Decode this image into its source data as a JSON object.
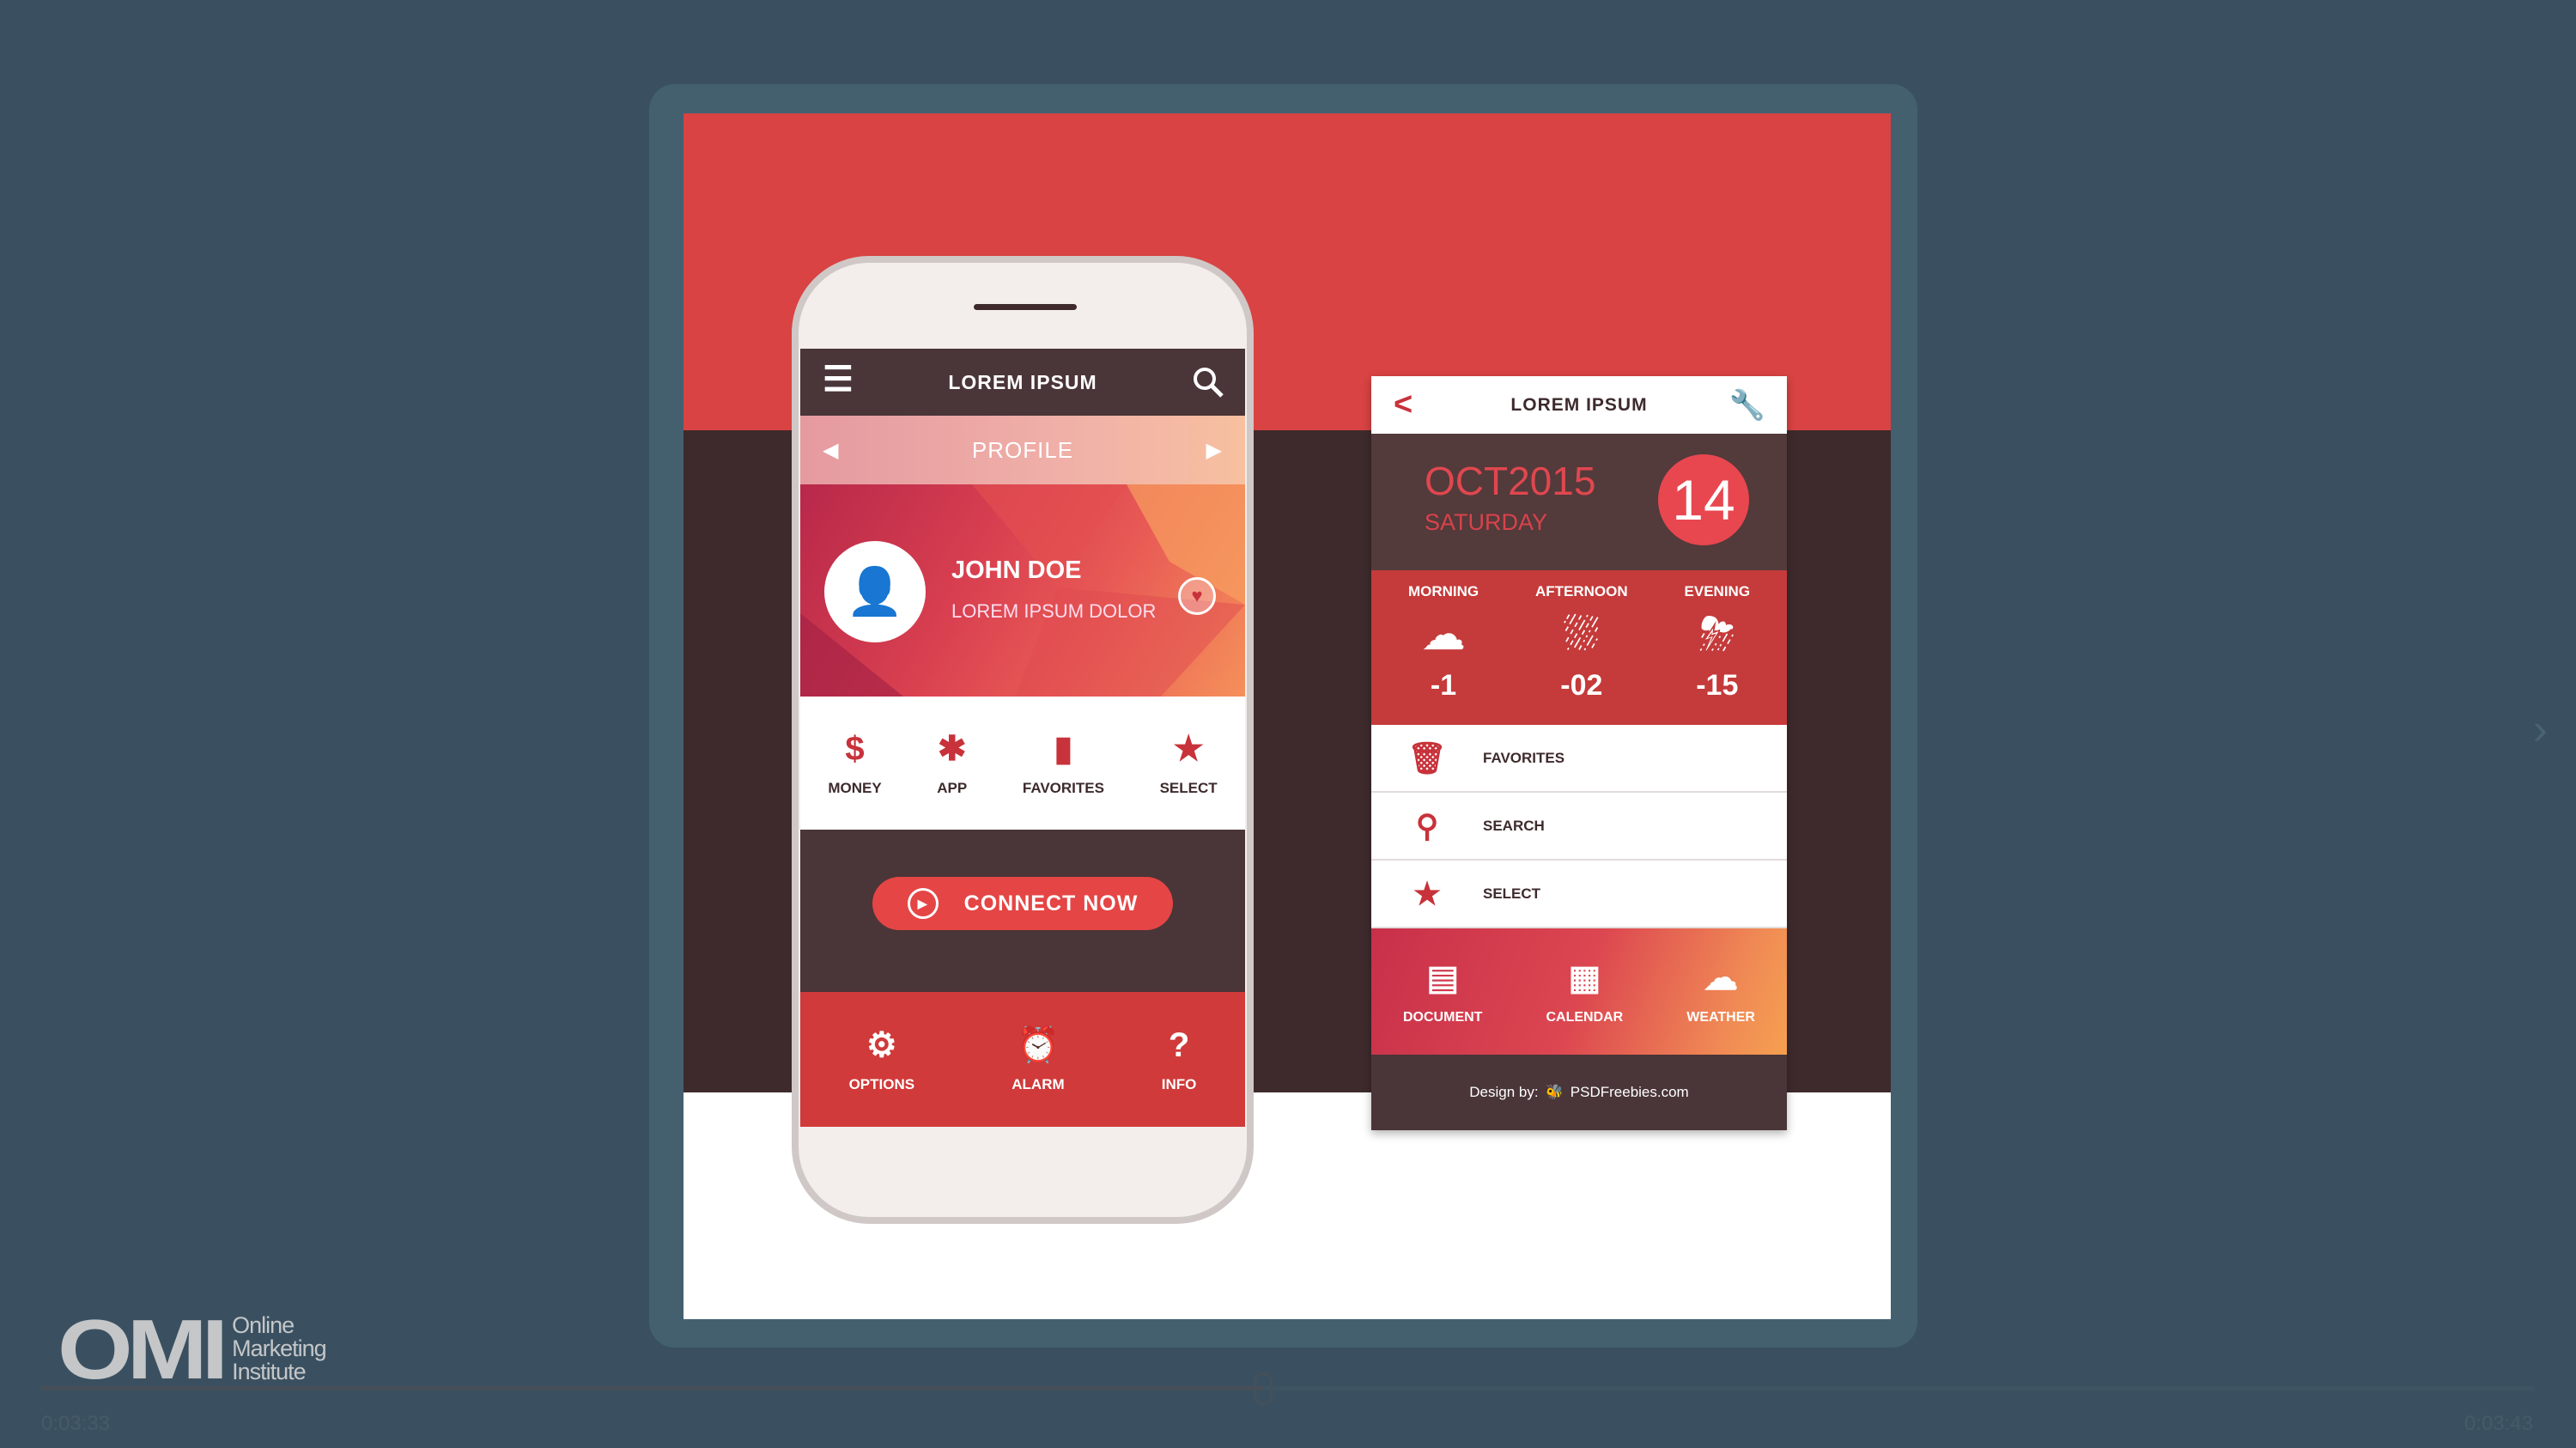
{
  "player": {
    "time_elapsed": "0:03:33",
    "time_total": "0:03:43",
    "progress": 0.49
  },
  "logo": {
    "mark": "OMI",
    "line1": "Online",
    "line2": "Marketing",
    "line3": "Institute"
  },
  "phone": {
    "header_title": "LOREM IPSUM",
    "profile_label": "PROFILE",
    "user_name": "JOHN DOE",
    "user_subtitle": "LOREM IPSUM DOLOR",
    "icons": [
      {
        "label": "MONEY",
        "icon": "dollar-icon"
      },
      {
        "label": "APP",
        "icon": "puzzle-icon"
      },
      {
        "label": "FAVORITES",
        "icon": "bookmark-icon"
      },
      {
        "label": "SELECT",
        "icon": "star-icon"
      }
    ],
    "connect_label": "CONNECT NOW",
    "bottom": [
      {
        "label": "OPTIONS",
        "icon": "gear-icon"
      },
      {
        "label": "ALARM",
        "icon": "alarm-icon"
      },
      {
        "label": "INFO",
        "icon": "question-icon"
      }
    ]
  },
  "card": {
    "header_title": "LOREM IPSUM",
    "month_year": "OCT2015",
    "weekday": "SATURDAY",
    "day": "14",
    "weather": [
      {
        "label": "MORNING",
        "temp": "-1",
        "icon": "cloud-icon"
      },
      {
        "label": "AFTERNOON",
        "temp": "-02",
        "icon": "rain-icon"
      },
      {
        "label": "EVENING",
        "temp": "-15",
        "icon": "storm-sun-icon"
      }
    ],
    "list": [
      {
        "label": "FAVORITES",
        "icon": "trash-icon"
      },
      {
        "label": "SEARCH",
        "icon": "search-icon"
      },
      {
        "label": "SELECT",
        "icon": "star-icon"
      }
    ],
    "icons": [
      {
        "label": "DOCUMENT",
        "icon": "document-icon"
      },
      {
        "label": "CALENDAR",
        "icon": "calendar-icon"
      },
      {
        "label": "WEATHER",
        "icon": "cloud-icon"
      }
    ],
    "footer_prefix": "Design by:",
    "footer_brand": "PSDFreebies.com"
  },
  "colors": {
    "accent": "#d94343",
    "dark": "#3e2a2c",
    "background": "#3a5060",
    "frame": "#44606f"
  }
}
